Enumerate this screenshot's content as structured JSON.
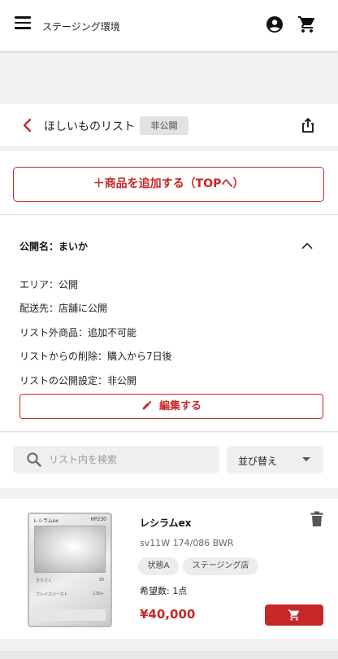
{
  "header": {
    "env_title": "ステージング環境",
    "icons": [
      "menu-icon",
      "account-icon",
      "cart-icon"
    ]
  },
  "list": {
    "title": "ほしいものリスト",
    "visibility_badge": "非公開"
  },
  "add_button_label": "＋商品を追加する（TOPへ）",
  "info": {
    "public_name": "公開名：まいか",
    "rows": [
      "エリア：公開",
      "配送先：店舗に公開",
      "リスト外商品：追加不可能",
      "リストからの削除：購入から7日後",
      "リストの公開設定：非公開"
    ],
    "edit_label": "編集する"
  },
  "search": {
    "placeholder": "リスト内を検索",
    "value": ""
  },
  "sort": {
    "selected": "並び替え"
  },
  "items": [
    {
      "name": "レシラムex",
      "code": "sv11W 174/086 BWR",
      "tags": [
        "状態A",
        "ステージング店"
      ],
      "want_count": "希望数: 1点",
      "price": "¥40,000",
      "card_text": {
        "name": "レシラムex",
        "hp": "HP230",
        "move1": "きりさく",
        "move1_dmg": "30",
        "move2": "ブレイズバースト",
        "move2_dmg": "130+"
      }
    }
  ],
  "colors": {
    "accent": "#c62828",
    "background": "#f2f2f2",
    "panel": "#ffffff"
  }
}
